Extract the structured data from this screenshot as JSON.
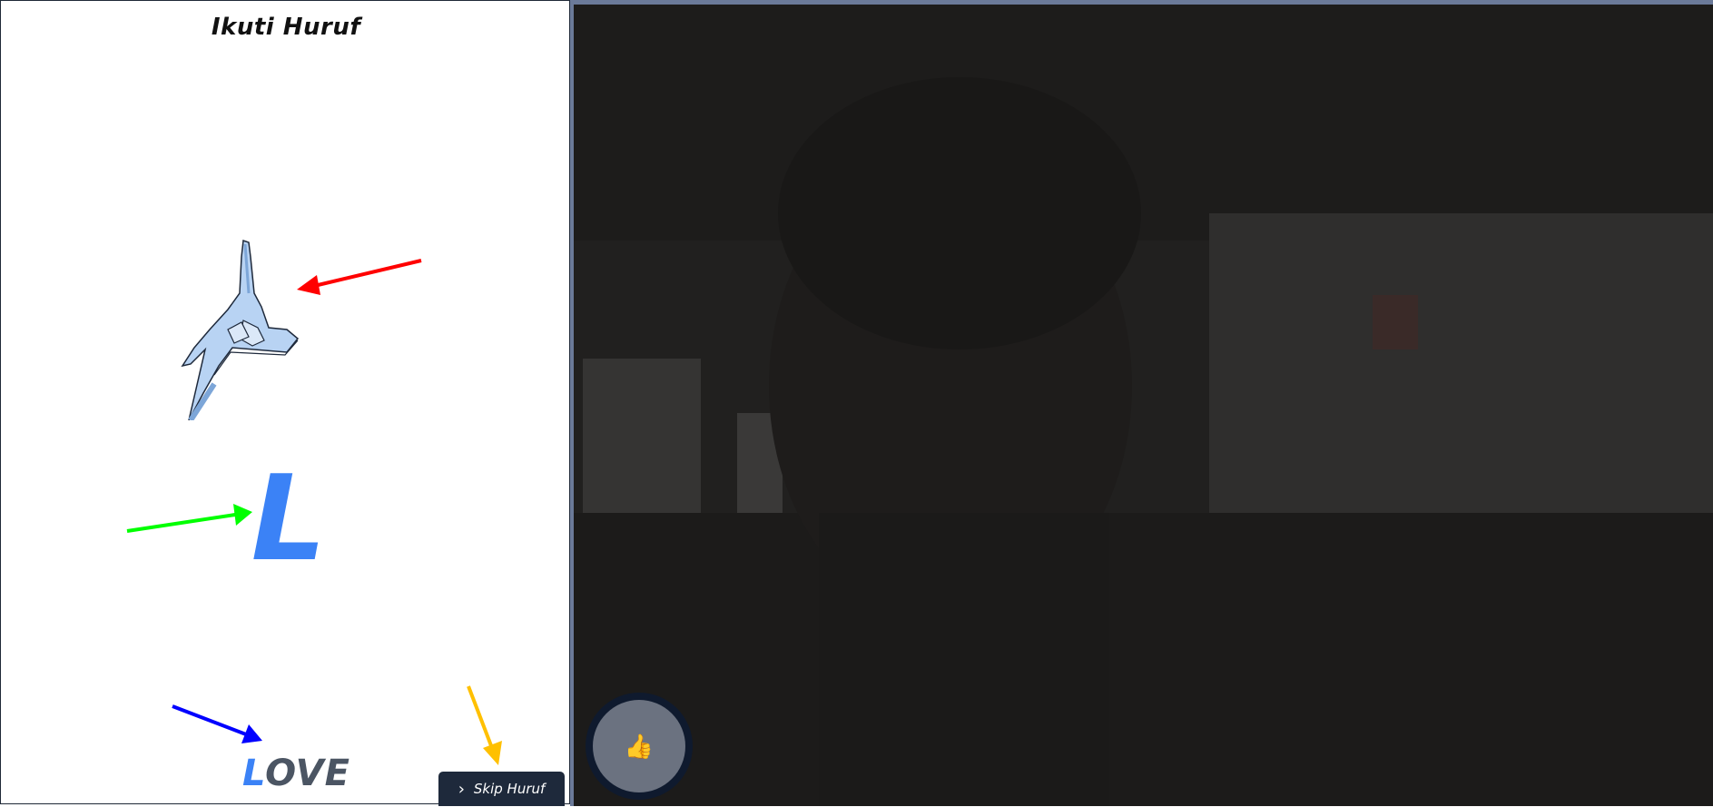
{
  "app": {
    "title": "Ikuti Huruf"
  },
  "lesson": {
    "current_letter": "L",
    "word_highlight": "L",
    "word_rest": "OVE",
    "hand_sign_icon": "hand-sign-l-icon"
  },
  "controls": {
    "skip_label": "Skip Huruf",
    "skip_icon": "chevron-right-icon",
    "thumb_glyph": "👍",
    "thumb_icon": "thumbs-up-icon"
  },
  "colors": {
    "accent": "#3b82f6",
    "word_text": "#4b5563",
    "button_bg": "#1e293b",
    "camera_border": "#6b7a99",
    "arrow_red": "#ff0000",
    "arrow_green": "#00ff00",
    "arrow_blue": "#0000ff",
    "arrow_yellow": "#ffc000"
  }
}
